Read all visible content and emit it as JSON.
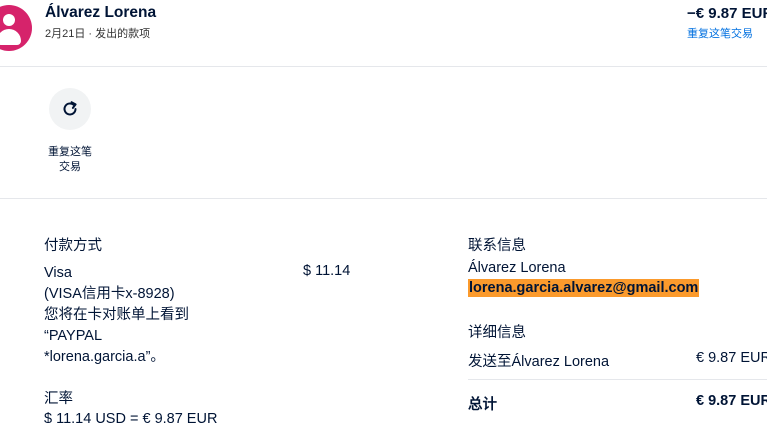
{
  "header": {
    "name": "Álvarez Lorena",
    "subtitle": "2月21日 · 发出的款项",
    "amount": "−€ 9.87 EUR",
    "repeat_link": "重复这笔交易"
  },
  "action": {
    "label_line1": "重复这笔",
    "label_line2": "交易",
    "icon": "refresh-icon"
  },
  "payment": {
    "title": "付款方式",
    "lines": [
      "Visa",
      "(VISA信用卡x-8928)",
      "您将在卡对账单上看到",
      "“PAYPAL",
      "*lorena.garcia.a”。"
    ],
    "amount": "$ 11.14"
  },
  "rate": {
    "title": "汇率",
    "line": "$ 11.14 USD = € 9.87 EUR"
  },
  "contact": {
    "title": "联系信息",
    "name": "Álvarez Lorena",
    "email": "lorena.garcia.alvarez@gmail.com"
  },
  "details": {
    "title": "详细信息",
    "sent_to_label": "发送至Álvarez Lorena",
    "sent_to_value": "€ 9.87 EUR",
    "total_label": "总计",
    "total_value": "€ 9.87 EUR"
  },
  "colors": {
    "avatar": "#d6236b",
    "link": "#0070e0",
    "highlight": "#fb9a2c"
  }
}
